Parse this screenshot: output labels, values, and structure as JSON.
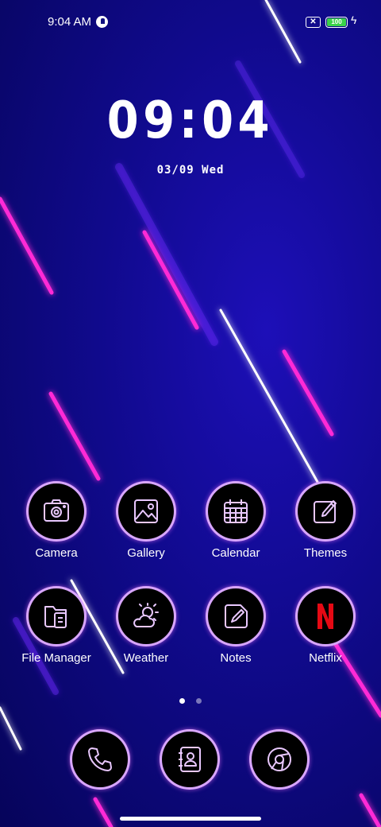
{
  "status_bar": {
    "time": "9:04 AM",
    "app_icon": "opera-icon",
    "sim_icon": "no-sim-icon",
    "sim_glyph": "✕",
    "battery_level": "100",
    "charging_icon": "bolt-icon"
  },
  "clock": {
    "time": "09:04",
    "date": "03/09 Wed"
  },
  "apps": [
    {
      "label": "Camera",
      "icon": "camera-icon"
    },
    {
      "label": "Gallery",
      "icon": "gallery-icon"
    },
    {
      "label": "Calendar",
      "icon": "calendar-icon"
    },
    {
      "label": "Themes",
      "icon": "themes-icon"
    },
    {
      "label": "File Manager",
      "icon": "file-manager-icon"
    },
    {
      "label": "Weather",
      "icon": "weather-icon"
    },
    {
      "label": "Notes",
      "icon": "notes-icon"
    },
    {
      "label": "Netflix",
      "icon": "netflix-icon"
    }
  ],
  "page_indicator": {
    "current": 1,
    "total": 2
  },
  "dock": [
    {
      "icon": "phone-icon"
    },
    {
      "icon": "contacts-icon"
    },
    {
      "icon": "browser-icon"
    }
  ],
  "colors": {
    "accent_pink": "#ff2bd6",
    "icon_ring": "#d8a6ff",
    "netflix_red": "#e50914",
    "background": "#100a8c"
  }
}
